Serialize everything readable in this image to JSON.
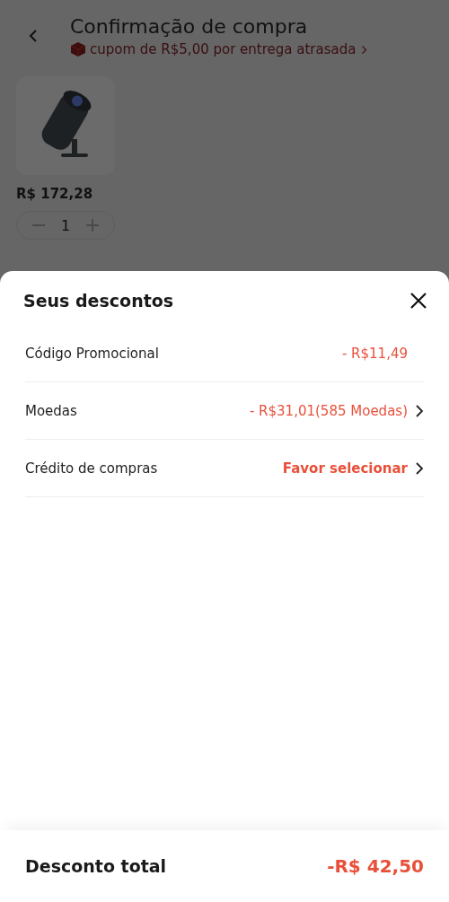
{
  "header": {
    "title": "Confirmação de compra",
    "coupon": "cupom de R$5,00 por entrega atrasada"
  },
  "product": {
    "price": "R$ 172,28",
    "quantity": "1"
  },
  "sheet": {
    "title": "Seus descontos",
    "rows": [
      {
        "label": "Código Promocional",
        "value": "- R$11,49",
        "kind": "amount",
        "arrow": false
      },
      {
        "label": "Moedas",
        "value": "- R$31,01(585 Moedas)",
        "kind": "amount",
        "arrow": true
      },
      {
        "label": "Crédito de compras",
        "value": "Favor selecionar",
        "kind": "select",
        "arrow": true
      }
    ],
    "total_label": "Desconto total",
    "total_value": "-R$ 42,50"
  }
}
